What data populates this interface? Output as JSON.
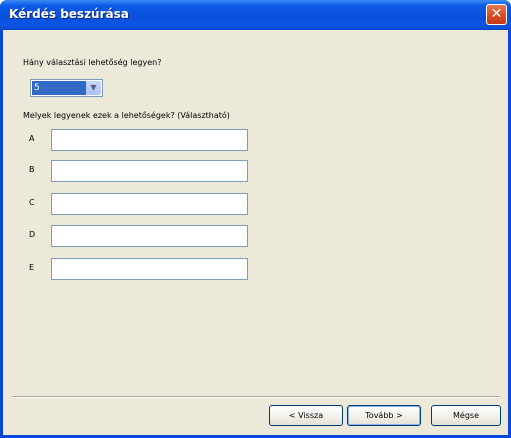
{
  "window": {
    "title": "Kérdés beszúrása",
    "close_symbol": "✕"
  },
  "question": {
    "label": "Hány választási lehetőség legyen?",
    "selected_count": "5",
    "dropdown_icon": "chevron-down-icon"
  },
  "options": {
    "label": "Melyek legyenek ezek a lehetőségek? (Választható)",
    "items": [
      {
        "letter": "A",
        "value": ""
      },
      {
        "letter": "B",
        "value": ""
      },
      {
        "letter": "C",
        "value": ""
      },
      {
        "letter": "D",
        "value": ""
      },
      {
        "letter": "E",
        "value": ""
      }
    ]
  },
  "buttons": {
    "back_label": "< Vissza",
    "next_label": "Tovább >",
    "cancel_label": "Mégse"
  },
  "colors": {
    "titlebar": "#0a4fdc",
    "dialog_bg": "#ece9d8",
    "selection": "#316ac5",
    "close": "#d8502a"
  }
}
